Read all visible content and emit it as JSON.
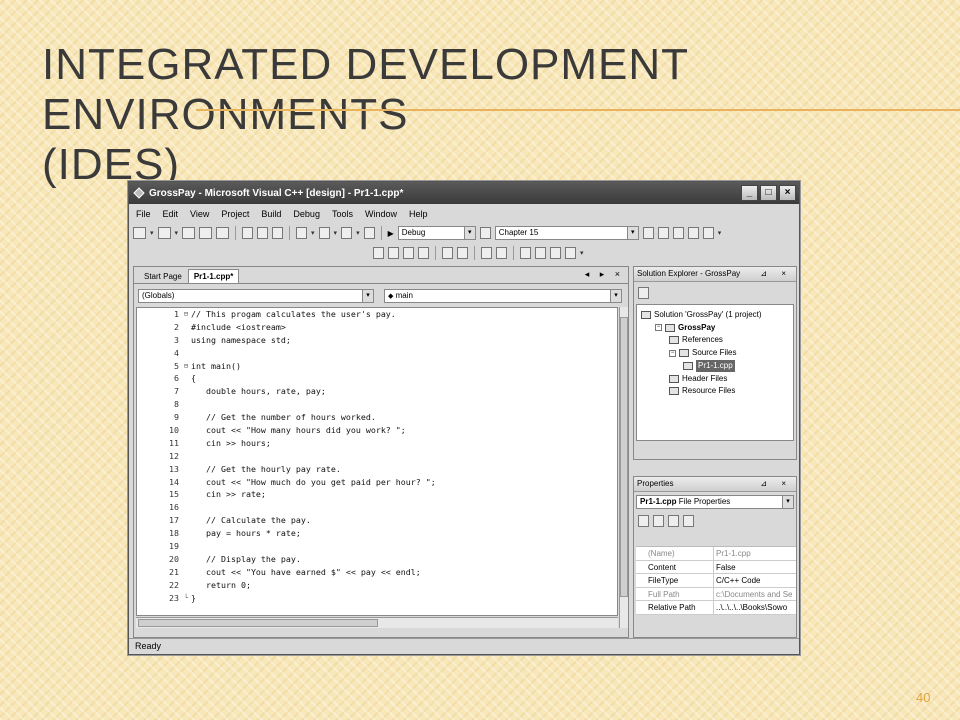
{
  "slide": {
    "title_line1": "Integrated Development Environments",
    "title_line2": "(IDEs)",
    "page_number": "40"
  },
  "window": {
    "title": "GrossPay - Microsoft Visual C++ [design] - Pr1-1.cpp*",
    "controls": {
      "minimize": "_",
      "maximize": "□",
      "close": "×"
    }
  },
  "menu": [
    "File",
    "Edit",
    "View",
    "Project",
    "Build",
    "Debug",
    "Tools",
    "Window",
    "Help"
  ],
  "toolbar": {
    "config_combo": "Debug",
    "find_combo": "Chapter 15"
  },
  "editor": {
    "tabs": [
      {
        "label": "Start Page",
        "active": false
      },
      {
        "label": "Pr1-1.cpp*",
        "active": true
      }
    ],
    "tab_controls": "◂ ▸ ×",
    "scope_combo": "(Globals)",
    "member_combo": "main",
    "lines": [
      {
        "n": "1",
        "fold": "⊟",
        "text": "// This progam calculates the user's pay."
      },
      {
        "n": "2",
        "fold": "",
        "text": "#include <iostream>"
      },
      {
        "n": "3",
        "fold": "",
        "text": "using namespace std;"
      },
      {
        "n": "4",
        "fold": "",
        "text": ""
      },
      {
        "n": "5",
        "fold": "⊟",
        "text": "int main()"
      },
      {
        "n": "6",
        "fold": "",
        "text": "{"
      },
      {
        "n": "7",
        "fold": "",
        "text": "   double hours, rate, pay;"
      },
      {
        "n": "8",
        "fold": "",
        "text": ""
      },
      {
        "n": "9",
        "fold": "",
        "text": "   // Get the number of hours worked."
      },
      {
        "n": "10",
        "fold": "",
        "text": "   cout << \"How many hours did you work? \";"
      },
      {
        "n": "11",
        "fold": "",
        "text": "   cin >> hours;"
      },
      {
        "n": "12",
        "fold": "",
        "text": ""
      },
      {
        "n": "13",
        "fold": "",
        "text": "   // Get the hourly pay rate."
      },
      {
        "n": "14",
        "fold": "",
        "text": "   cout << \"How much do you get paid per hour? \";"
      },
      {
        "n": "15",
        "fold": "",
        "text": "   cin >> rate;"
      },
      {
        "n": "16",
        "fold": "",
        "text": ""
      },
      {
        "n": "17",
        "fold": "",
        "text": "   // Calculate the pay."
      },
      {
        "n": "18",
        "fold": "",
        "text": "   pay = hours * rate;"
      },
      {
        "n": "19",
        "fold": "",
        "text": ""
      },
      {
        "n": "20",
        "fold": "",
        "text": "   // Display the pay."
      },
      {
        "n": "21",
        "fold": "",
        "text": "   cout << \"You have earned $\" << pay << endl;"
      },
      {
        "n": "22",
        "fold": "",
        "text": "   return 0;"
      },
      {
        "n": "23",
        "fold": "└",
        "text": "}"
      }
    ]
  },
  "solution_explorer": {
    "title": "Solution Explorer - GrossPay",
    "controls": "⊿ ×",
    "items": [
      {
        "label": "Solution 'GrossPay' (1 project)",
        "level": 0,
        "exp": "",
        "bold": false,
        "selected": false
      },
      {
        "label": "GrossPay",
        "level": 1,
        "exp": "−",
        "bold": true,
        "selected": false
      },
      {
        "label": "References",
        "level": 2,
        "exp": "",
        "bold": false,
        "selected": false
      },
      {
        "label": "Source Files",
        "level": 2,
        "exp": "−",
        "bold": false,
        "selected": false
      },
      {
        "label": "Pr1-1.cpp",
        "level": 3,
        "exp": "",
        "bold": false,
        "selected": true
      },
      {
        "label": "Header Files",
        "level": 2,
        "exp": "",
        "bold": false,
        "selected": false
      },
      {
        "label": "Resource Files",
        "level": 2,
        "exp": "",
        "bold": false,
        "selected": false
      }
    ]
  },
  "properties": {
    "title": "Properties",
    "controls": "⊿ ×",
    "object_combo_bold": "Pr1-1.cpp",
    "object_combo_rest": "File Properties",
    "rows": [
      {
        "name": "(Name)",
        "value": "Pr1-1.cpp",
        "dim": true
      },
      {
        "name": "Content",
        "value": "False",
        "dim": false
      },
      {
        "name": "FileType",
        "value": "C/C++ Code",
        "dim": false
      },
      {
        "name": "Full Path",
        "value": "c:\\Documents and Se",
        "dim": true
      },
      {
        "name": "Relative Path",
        "value": "..\\..\\..\\..\\Books\\Sowo",
        "dim": false
      }
    ]
  },
  "status": {
    "text": "Ready"
  }
}
